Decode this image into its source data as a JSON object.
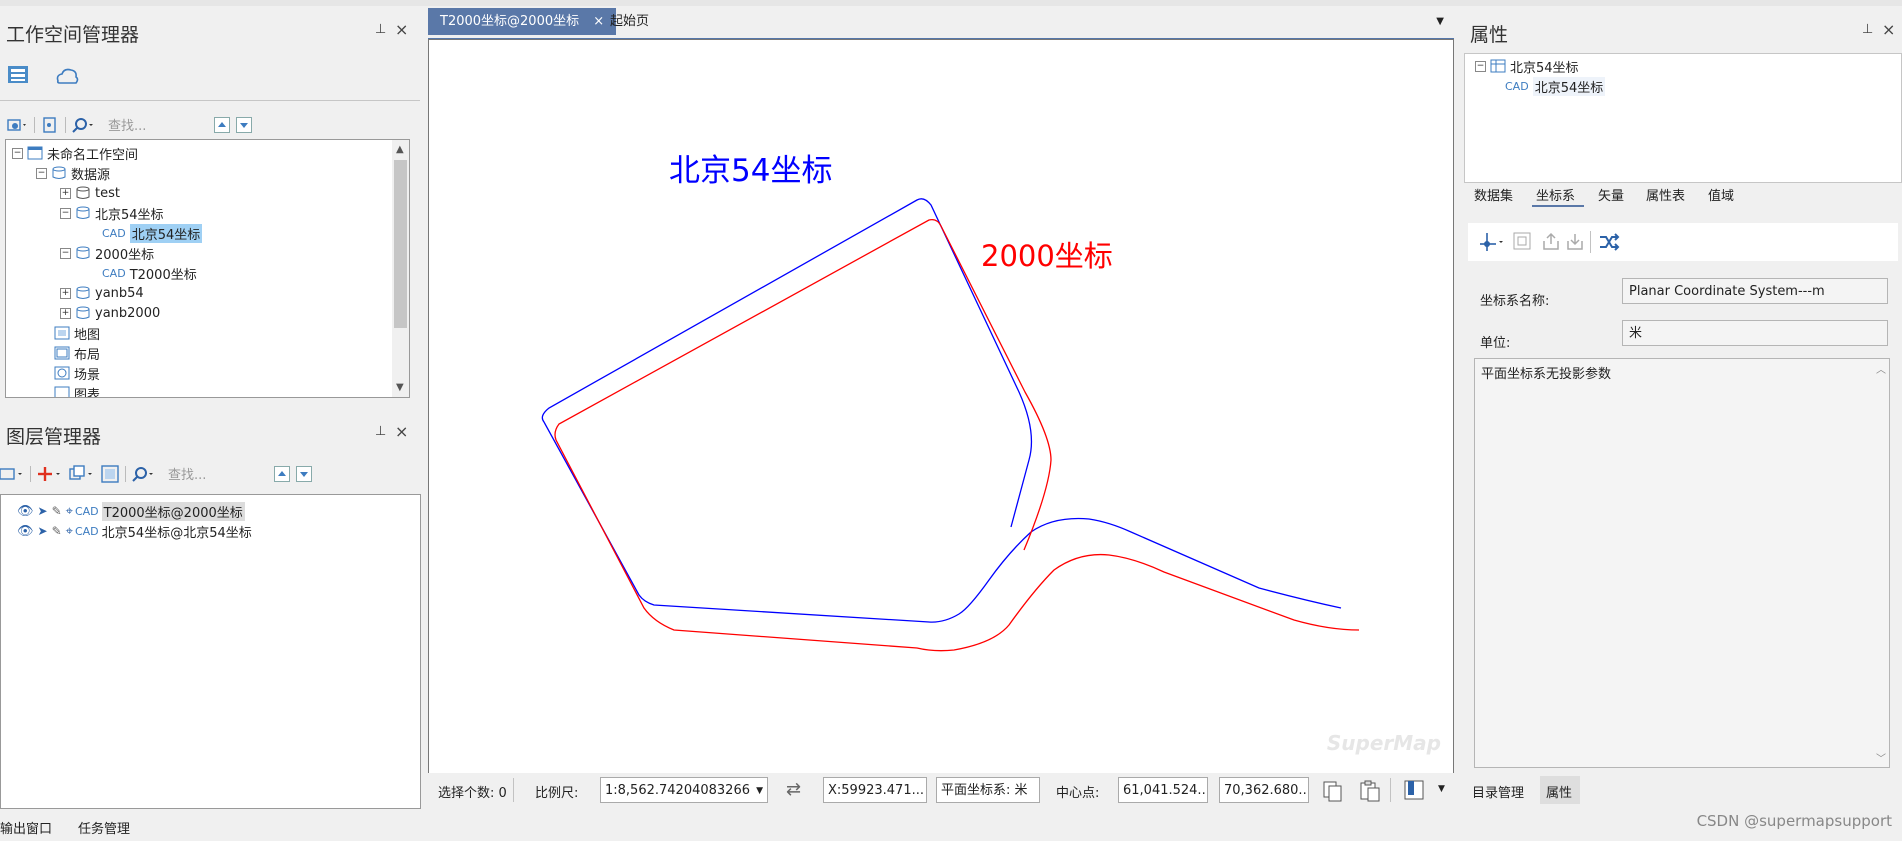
{
  "workspace_panel": {
    "title": "工作空间管理器",
    "search_placeholder": "查找...",
    "tree": {
      "root": "未命名工作空间",
      "datasources": "数据源",
      "ds_test": "test",
      "ds_bj54": "北京54坐标",
      "ds_bj54_child": "北京54坐标",
      "ds_2000": "2000坐标",
      "ds_2000_child": "T2000坐标",
      "ds_yanb54": "yanb54",
      "ds_yanb2000": "yanb2000",
      "maps": "地图",
      "layouts": "布局",
      "scenes": "场景",
      "resources": "图表"
    }
  },
  "layer_panel": {
    "title": "图层管理器",
    "search_placeholder": "查找...",
    "layers": [
      "T2000坐标@2000坐标",
      "北京54坐标@北京54坐标"
    ]
  },
  "bottom_tabs": [
    "输出窗口",
    "任务管理"
  ],
  "doc_tabs": {
    "active": "T2000坐标@2000坐标",
    "other": "起始页"
  },
  "map": {
    "label_blue": "北京54坐标",
    "label_red": "2000坐标",
    "blue_color": "#0000ff",
    "red_color": "#ff0000",
    "watermark": "SuperMap"
  },
  "status": {
    "select_count_label": "选择个数: 0",
    "scale_label": "比例尺:",
    "scale_value": "1:8,562.74204083266",
    "x_value": "X:59923.471...",
    "coord_system": "平面坐标系: 米",
    "center_label": "中心点:",
    "center_x": "61,041.524...",
    "center_y": "70,362.680..."
  },
  "props_panel": {
    "title": "属性",
    "tree_parent": "北京54坐标",
    "tree_child": "北京54坐标",
    "tabs": [
      "数据集",
      "坐标系",
      "矢量",
      "属性表",
      "值域"
    ],
    "active_tab": "坐标系",
    "cs_name_label": "坐标系名称:",
    "cs_name_value": "Planar Coordinate System---m",
    "unit_label": "单位:",
    "unit_value": "米",
    "description": "平面坐标系无投影参数",
    "bottom_tabs": [
      "目录管理",
      "属性"
    ]
  },
  "footer_watermark": "CSDN @supermapsupport"
}
